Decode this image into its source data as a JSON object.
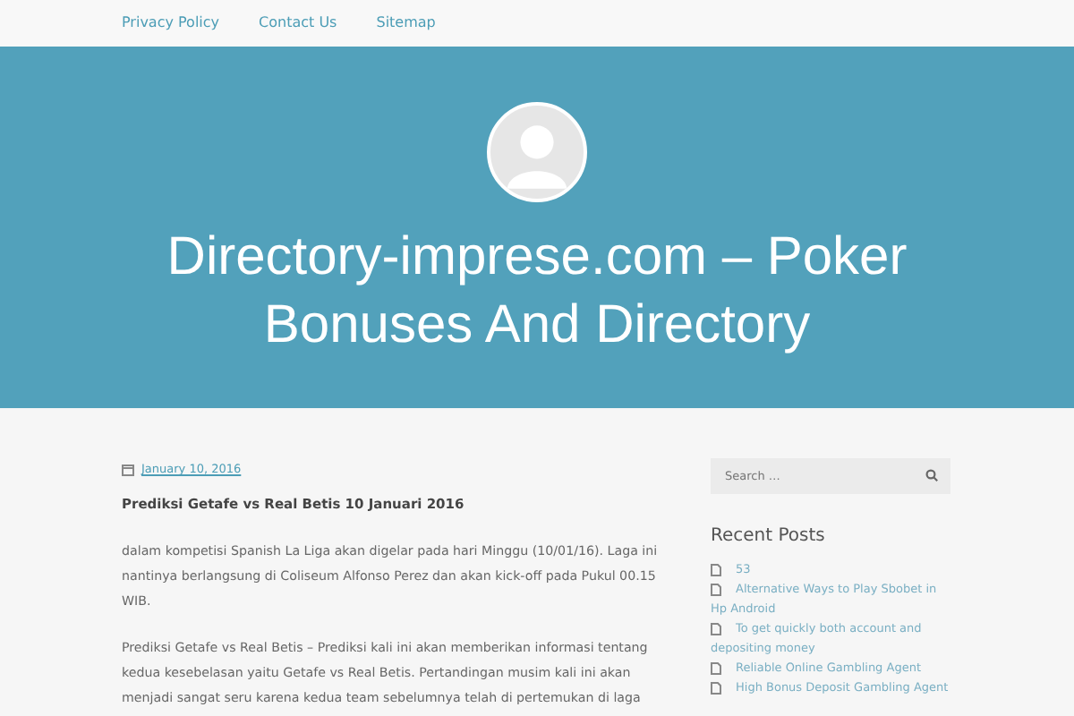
{
  "nav": [
    {
      "label": "Privacy Policy"
    },
    {
      "label": "Contact Us"
    },
    {
      "label": "Sitemap"
    }
  ],
  "site_title": "Directory-imprese.com – Poker Bonuses And Directory",
  "post": {
    "date": "January 10, 2016",
    "title": "Prediksi Getafe vs Real Betis 10 Januari 2016",
    "paragraphs": [
      "dalam kompetisi Spanish La Liga akan digelar pada hari Minggu (10/01/16). Laga ini nantinya berlangsung di Coliseum Alfonso Perez dan akan kick-off pada Pukul 00.15 WIB.",
      "Prediksi Getafe vs Real Betis – Prediksi kali ini akan memberikan informasi tentang kedua kesebelasan yaitu Getafe vs Real Betis. Pertandingan musim kali ini akan menjadi sangat seru karena kedua team sebelumnya telah di pertemukan di laga"
    ]
  },
  "sidebar": {
    "search": {
      "placeholder": "Search …"
    },
    "recent_title": "Recent Posts",
    "recent_posts": [
      "53",
      "Alternative Ways to Play Sbobet in Hp Android",
      "To get quickly both account and depositing money",
      "Reliable Online Gambling Agent",
      "High Bonus Deposit Gambling Agent"
    ]
  }
}
